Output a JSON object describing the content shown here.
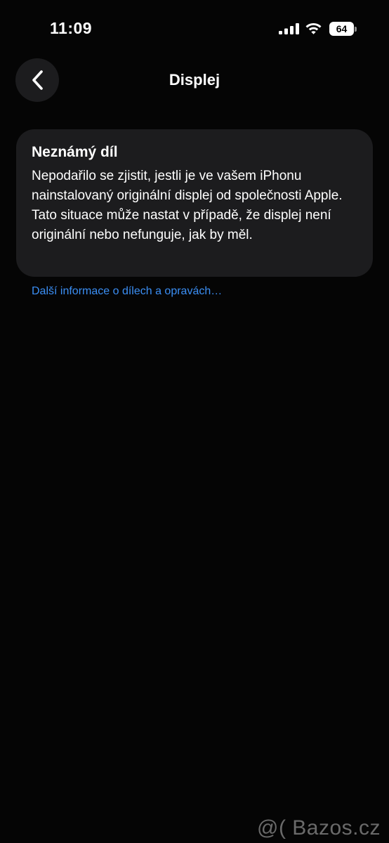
{
  "status_bar": {
    "time": "11:09",
    "battery_level": "64",
    "signal_bars": 4,
    "icons": [
      "cellular-signal-icon",
      "wifi-icon",
      "battery-icon"
    ]
  },
  "nav": {
    "back_icon": "chevron-left-icon",
    "title": "Displej"
  },
  "card": {
    "title": "Neznámý díl",
    "body": "Nepodařilo se zjistit, jestli je ve vašem iPhonu nainstalovaný originální displej od společnosti Apple. Tato situace může nastat v případě, že displej není originální nebo nefunguje, jak by měl."
  },
  "link": {
    "label": "Další informace o dílech a opravách…",
    "color": "#3b8ff5"
  },
  "watermark": {
    "text": "@( Bazos.cz"
  },
  "colors": {
    "background": "#050505",
    "card": "#1c1c1e",
    "text": "#ffffff"
  }
}
